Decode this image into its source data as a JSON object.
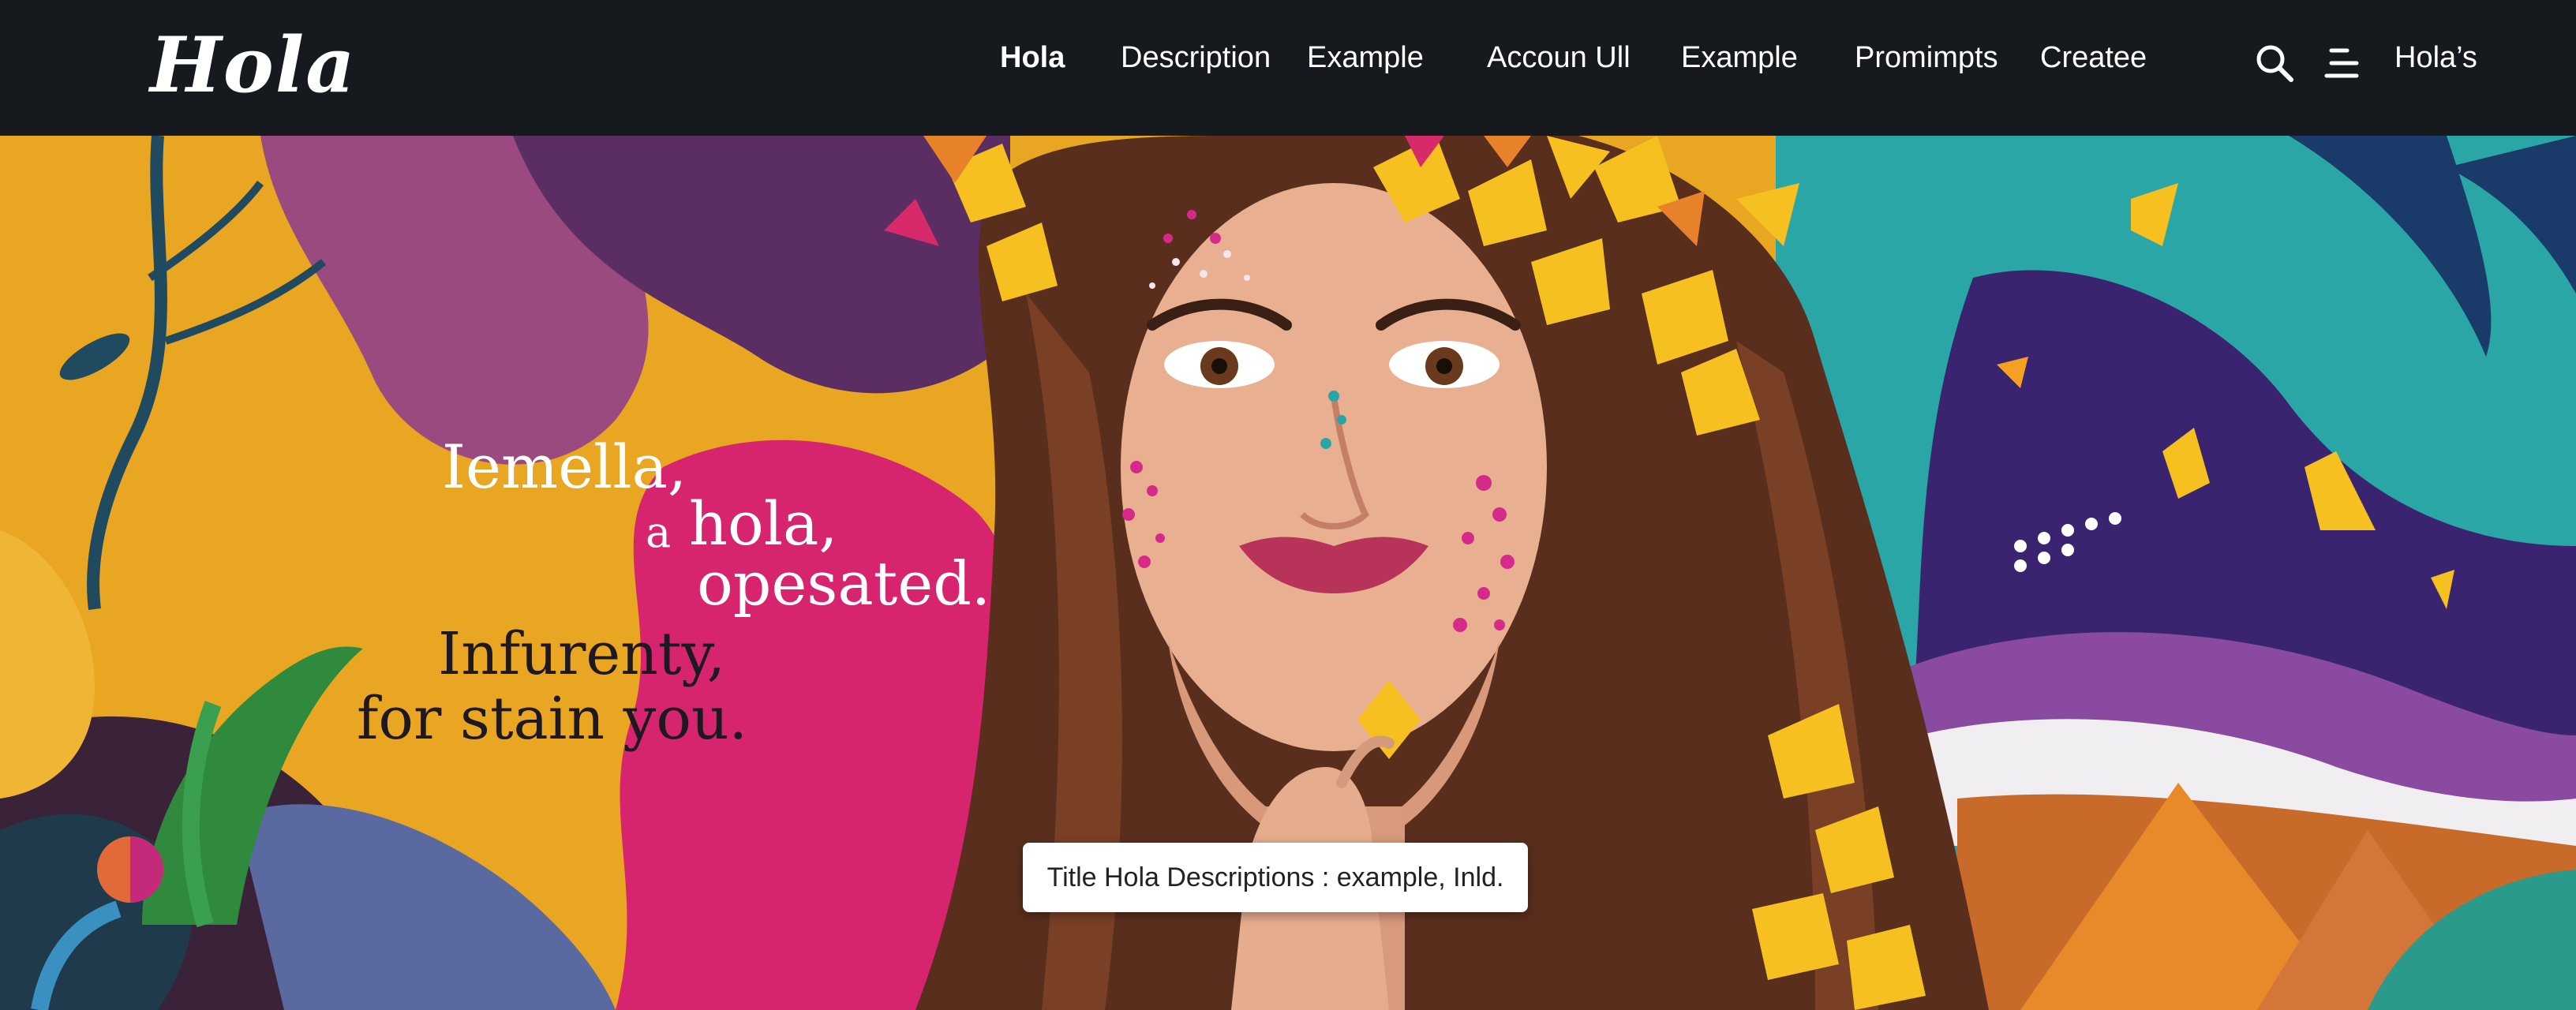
{
  "brand": {
    "logo_text": "Hola"
  },
  "nav": {
    "items": [
      {
        "label": "Hola",
        "active": true
      },
      {
        "label": "Description"
      },
      {
        "label": "Example"
      },
      {
        "label": "Accoun Ull"
      },
      {
        "label": "Example"
      },
      {
        "label": "Promimpts"
      },
      {
        "label": "Createe"
      }
    ],
    "account_label": "Hola’s",
    "icons": [
      "search-icon",
      "menu-icon"
    ]
  },
  "hero": {
    "headline": {
      "line1": "Iemella,",
      "line2_prefix": "a",
      "line2": "hola,",
      "line3": "opesated."
    },
    "subheadline": {
      "line1": "Infurenty,",
      "line2": "for stain you."
    },
    "caption": "Title Hola Descriptions : example, Inld.",
    "image": "woman-with-flower-crown-illustration"
  },
  "colors": {
    "nav_bg": "#161a1e",
    "orange": "#e8a020",
    "magenta": "#d8207a",
    "purple": "#5a2a6a",
    "teal": "#2aa5a5",
    "yellow": "#f5c020"
  }
}
